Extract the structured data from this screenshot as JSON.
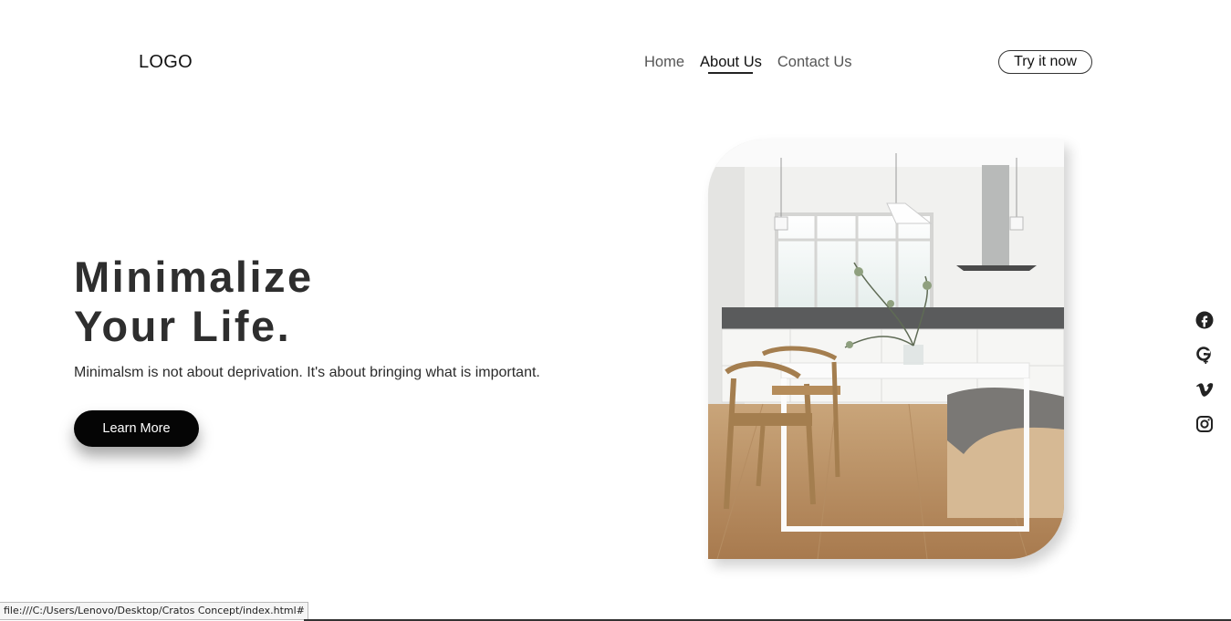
{
  "header": {
    "logo": "LOGO",
    "nav": [
      {
        "label": "Home",
        "active": false
      },
      {
        "label": "About Us",
        "active": true
      },
      {
        "label": "Contact Us",
        "active": false
      }
    ],
    "cta_label": "Try it now"
  },
  "hero": {
    "title_line1": "Minimalize",
    "title_line2": "Your Life.",
    "subtitle": "Minimalsm is not about deprivation. It's about bringing what is important.",
    "button_label": "Learn More",
    "image_subject": "minimalist-kitchen-dining-photo"
  },
  "social": [
    "facebook-icon",
    "google-plus-icon",
    "vimeo-icon",
    "instagram-icon"
  ],
  "statusbar": {
    "url": "file:///C:/Users/Lenovo/Desktop/Cratos Concept/index.html#"
  },
  "colors": {
    "text": "#2e2e2e",
    "button_bg": "#050505",
    "button_text": "#ffffff",
    "background": "#ffffff"
  }
}
